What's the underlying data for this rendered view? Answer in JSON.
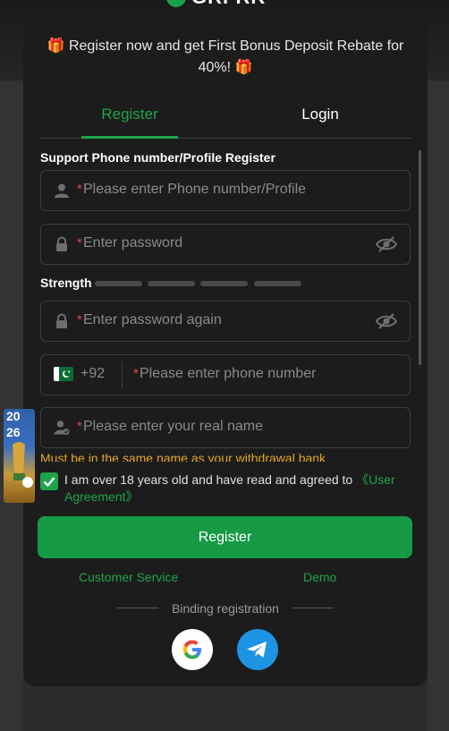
{
  "header": {
    "logo_text": "GRFRR"
  },
  "banner": {
    "gift_left": "🎁",
    "text": "Register now and get First Bonus Deposit Rebate for 40%!",
    "gift_right": "🎁"
  },
  "tabs": {
    "register": "Register",
    "login": "Login"
  },
  "form": {
    "section_label": "Support Phone number/Profile Register",
    "account": {
      "required": "*",
      "placeholder": "Please enter Phone number/Profile"
    },
    "password": {
      "required": "*",
      "placeholder": "Enter password"
    },
    "strength_label": "Strength",
    "password_again": {
      "required": "*",
      "placeholder": "Enter password again"
    },
    "phone": {
      "country_code": "+92",
      "required": "*",
      "placeholder": "Please enter phone number"
    },
    "real_name": {
      "required": "*",
      "placeholder": "Please enter your real name"
    },
    "warning": "Must be in the same name as your withdrawal bank",
    "agreement_text": "I am over 18 years old and have read and agreed to",
    "agreement_link": "《User Agreement》",
    "agreement_checked": true
  },
  "buttons": {
    "register": "Register"
  },
  "links": {
    "customer_service": "Customer Service",
    "demo": "Demo"
  },
  "binding": {
    "label": "Binding registration"
  },
  "float_ad": {
    "year_top": "20",
    "year_bottom": "26"
  },
  "colors": {
    "accent": "#1ea34a",
    "required": "#d84a4a",
    "warning": "#e5a623",
    "telegram": "#1c93e3"
  }
}
